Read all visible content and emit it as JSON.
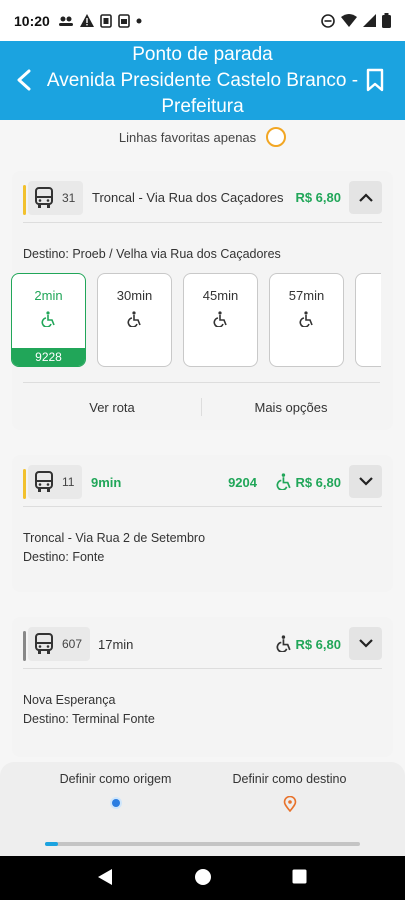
{
  "status_bar": {
    "time": "10:20"
  },
  "header": {
    "line1": "Ponto de parada",
    "line2": "Avenida Presidente Castelo Branco -",
    "line3": "Prefeitura"
  },
  "favorites": {
    "label": "Linhas favoritas apenas"
  },
  "cards": [
    {
      "line_number": "31",
      "route_name": "Troncal - Via Rua dos Caçadores",
      "price": "R$ 6,80",
      "accent_color": "#f2c12e",
      "destination": "Destino: Proeb / Velha via Rua dos Caçadores",
      "arrivals": [
        {
          "time": "2min",
          "vehicle": "9228"
        },
        {
          "time": "30min"
        },
        {
          "time": "45min"
        },
        {
          "time": "57min"
        }
      ],
      "actions": {
        "route": "Ver rota",
        "more": "Mais opções"
      }
    },
    {
      "line_number": "11",
      "eta": "9min",
      "vehicle": "9204",
      "price": "R$ 6,80",
      "accent_color": "#f2c12e",
      "description": "Troncal - Via Rua 2 de Setembro",
      "destination": "Destino: Fonte"
    },
    {
      "line_number": "607",
      "eta": "17min",
      "price": "R$ 6,80",
      "accent_color": "#888888",
      "description": "Nova Esperança",
      "destination": "Destino: Terminal Fonte"
    }
  ],
  "bottom": {
    "origin_label": "Definir como origem",
    "destination_label": "Definir como destino",
    "scroll_progress": 0.04
  },
  "colors": {
    "primary": "#1ba3e0",
    "green": "#21a659",
    "orange": "#f2a623"
  }
}
